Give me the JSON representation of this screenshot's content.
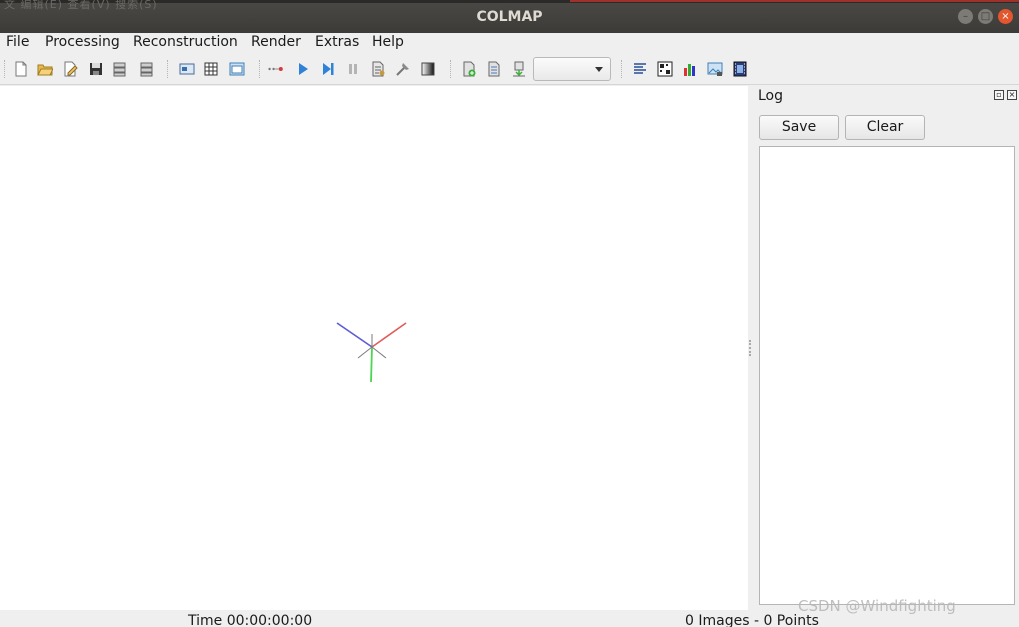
{
  "window": {
    "title": "COLMAP",
    "background_menu_ghost": "文 编辑(E) 查看(V) 搜索(S)",
    "controls": {
      "minimize": "–",
      "maximize": "□",
      "close": "×"
    }
  },
  "menu": {
    "items": [
      "File",
      "Processing",
      "Reconstruction",
      "Render",
      "Extras",
      "Help"
    ]
  },
  "toolbar": {
    "icons": [
      "new-project-icon",
      "open-project-icon",
      "edit-project-icon",
      "save-project-icon",
      "import-model-icon",
      "export-model-icon",
      "feature-extraction-icon",
      "feature-matching-icon",
      "database-management-icon",
      "automatic-reconstruction-icon",
      "start-reconstruction-icon",
      "step-reconstruction-icon",
      "pause-reconstruction-icon",
      "reconstruction-options-icon",
      "bundle-adjustment-icon",
      "render-toggle-icon",
      "model-import-icon",
      "model-export-icon",
      "model-download-icon",
      "log-icon",
      "match-matrix-icon",
      "reconstruction-stats-icon",
      "render-options-icon",
      "grab-movie-icon"
    ],
    "reconstruction_select_value": ""
  },
  "log": {
    "title": "Log",
    "save_label": "Save",
    "clear_label": "Clear",
    "content": ""
  },
  "status": {
    "time": "Time 00:00:00:00",
    "counts": "0 Images - 0 Points"
  },
  "watermark": "CSDN @Windfighting",
  "colors": {
    "axis_x": "#e25b5b",
    "axis_y": "#4fd44f",
    "axis_z": "#5b5bd8",
    "close_button": "#e4572e"
  }
}
